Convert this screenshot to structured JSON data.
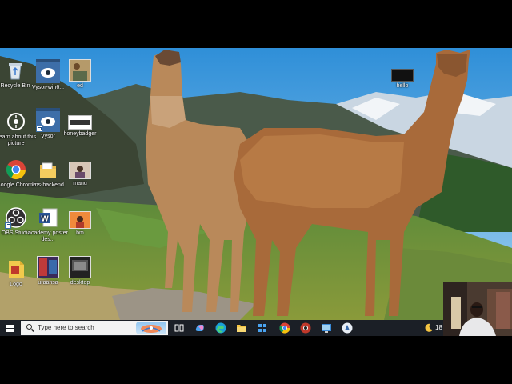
{
  "desktop": {
    "icons": [
      {
        "label": "Recycle Bin",
        "icon": "recycle-bin-icon"
      },
      {
        "label": "Vysor-win6...",
        "icon": "vysor-icon"
      },
      {
        "label": "ed",
        "icon": "image-file-icon"
      },
      {
        "label": "Learn about this picture",
        "icon": "learn-about-picture-icon"
      },
      {
        "label": "Vysor",
        "icon": "vysor-icon"
      },
      {
        "label": "honeybadger",
        "icon": "image-file-icon"
      },
      {
        "label": "Google Chrome",
        "icon": "chrome-icon"
      },
      {
        "label": "lms-backend",
        "icon": "folder-icon"
      },
      {
        "label": "manu",
        "icon": "image-file-icon"
      },
      {
        "label": "OBS Studio",
        "icon": "obs-icon"
      },
      {
        "label": "academy poster des...",
        "icon": "word-icon"
      },
      {
        "label": "bm",
        "icon": "image-file-icon"
      },
      {
        "label": "Logo",
        "icon": "pdf-icon"
      },
      {
        "label": "uraansa",
        "icon": "image-file-icon"
      },
      {
        "label": "desktop",
        "icon": "image-file-icon"
      },
      {
        "label": "hello",
        "icon": "image-file-icon"
      }
    ]
  },
  "taskbar": {
    "search_placeholder": "Type here to search",
    "apps": [
      "task-view-icon",
      "copilot-icon",
      "edge-icon",
      "file-explorer-icon",
      "apps-grid-icon",
      "chrome-icon",
      "chrome-profile-icon",
      "remote-desktop-icon",
      "vysor-app-icon"
    ],
    "clock_partial": "18"
  },
  "colors": {
    "taskbar": "#1b1f26",
    "search_box": "#f3f3f3",
    "letterbox": "#000000"
  }
}
